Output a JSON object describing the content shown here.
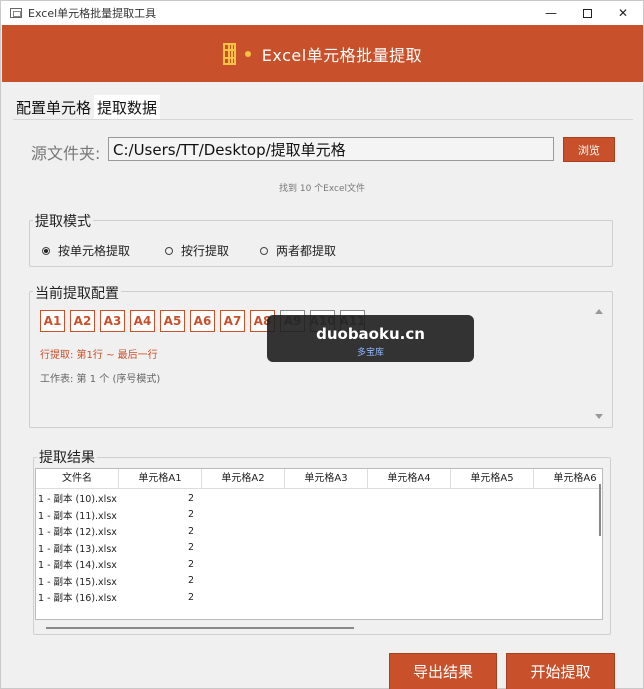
{
  "window": {
    "title": "Excel单元格批量提取工具",
    "controls": {
      "minimize": "—",
      "close": "✕"
    }
  },
  "header": {
    "title": "Excel单元格批量提取"
  },
  "tabs": [
    {
      "label": "配置单元格"
    },
    {
      "label": "提取数据",
      "active": true
    }
  ],
  "source": {
    "label": "源文件夹:",
    "path": "C:/Users/TT/Desktop/提取单元格",
    "browse_label": "浏览",
    "found_text": "找到 10 个Excel文件"
  },
  "mode": {
    "title": "提取模式",
    "options": [
      {
        "label": "按单元格提取",
        "selected": true
      },
      {
        "label": "按行提取",
        "selected": false
      },
      {
        "label": "两者都提取",
        "selected": false
      }
    ]
  },
  "config": {
    "title": "当前提取配置",
    "cells": [
      "A1",
      "A2",
      "A3",
      "A4",
      "A5",
      "A6",
      "A7",
      "A8",
      "A9",
      "A10",
      "A11"
    ],
    "row_info": "行提取: 第1行 ~ 最后一行",
    "sheet_info": "工作表: 第 1 个 (序号模式)"
  },
  "watermark": {
    "line1": "duobaoku.cn",
    "line2": "多宝库"
  },
  "results": {
    "title": "提取结果",
    "columns": [
      "文件名",
      "单元格A1",
      "单元格A2",
      "单元格A3",
      "单元格A4",
      "单元格A5",
      "单元格A6"
    ],
    "rows": [
      [
        "1 - 副本 (10).xlsx",
        "2"
      ],
      [
        "1 - 副本 (11).xlsx",
        "2"
      ],
      [
        "1 - 副本 (12).xlsx",
        "2"
      ],
      [
        "1 - 副本 (13).xlsx",
        "2"
      ],
      [
        "1 - 副本 (14).xlsx",
        "2"
      ],
      [
        "1 - 副本 (15).xlsx",
        "2"
      ],
      [
        "1 - 副本 (16).xlsx",
        "2"
      ]
    ]
  },
  "actions": {
    "export_label": "导出结果",
    "start_label": "开始提取"
  },
  "colors": {
    "accent": "#c8502a",
    "icon": "#f6c244"
  }
}
